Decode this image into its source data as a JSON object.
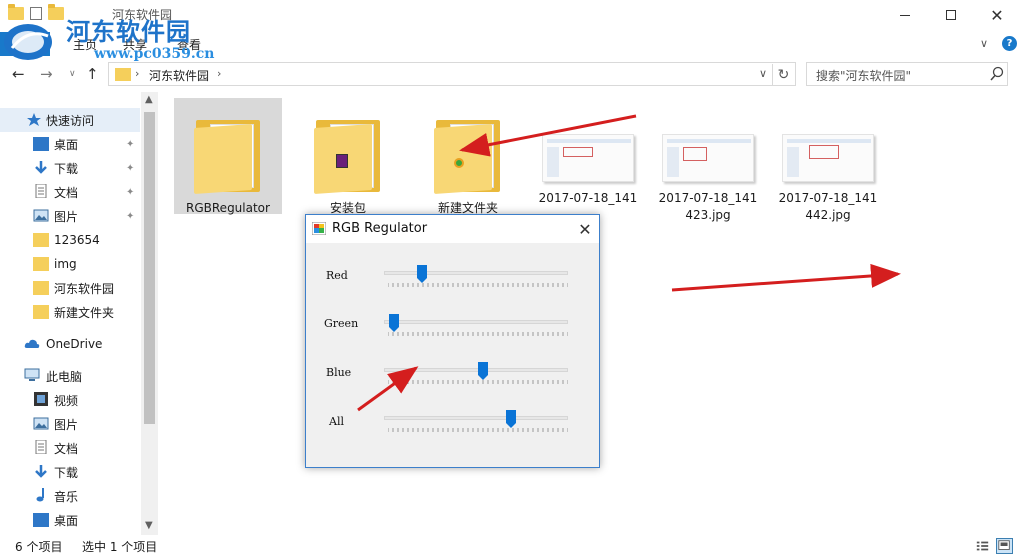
{
  "window": {
    "title": "河东软件园",
    "close_glyph": "✕",
    "help_glyph": "?",
    "ribbon_chevron": "∨"
  },
  "watermark": {
    "title": "河东软件园",
    "url": "www.pc0359.cn"
  },
  "ribbon": {
    "tabs": [
      {
        "label": "文件"
      },
      {
        "label": "主页"
      },
      {
        "label": "共享"
      },
      {
        "label": "查看"
      }
    ]
  },
  "address": {
    "path": "河东软件园",
    "sep": "›",
    "dropdown_glyph": "∨",
    "refresh_glyph": "↻"
  },
  "search": {
    "placeholder": "搜索\"河东软件园\""
  },
  "nav": {
    "back_glyph": "←",
    "forward_glyph": "→",
    "recent_glyph": "∨",
    "up_glyph": "↑"
  },
  "sidebar": {
    "items": [
      {
        "label": "快速访问",
        "icon": "star-icon"
      },
      {
        "label": "桌面",
        "icon": "desktop-icon",
        "pinned": true
      },
      {
        "label": "下载",
        "icon": "download-icon",
        "pinned": true
      },
      {
        "label": "文档",
        "icon": "document-icon",
        "pinned": true
      },
      {
        "label": "图片",
        "icon": "pictures-icon",
        "pinned": true
      },
      {
        "label": "123654",
        "icon": "folder-icon"
      },
      {
        "label": "img",
        "icon": "folder-icon"
      },
      {
        "label": "河东软件园",
        "icon": "folder-icon"
      },
      {
        "label": "新建文件夹",
        "icon": "folder-icon"
      },
      {
        "label": "OneDrive",
        "icon": "cloud-icon"
      },
      {
        "label": "此电脑",
        "icon": "computer-icon"
      },
      {
        "label": "视频",
        "icon": "video-icon"
      },
      {
        "label": "图片",
        "icon": "pictures-icon"
      },
      {
        "label": "文档",
        "icon": "document-icon"
      },
      {
        "label": "下载",
        "icon": "download-icon"
      },
      {
        "label": "音乐",
        "icon": "music-icon"
      },
      {
        "label": "桌面",
        "icon": "desktop-icon"
      }
    ],
    "pin_glyph": "📌"
  },
  "files": [
    {
      "name": "RGBRegulator",
      "type": "folder",
      "selected": true
    },
    {
      "name": "安装包",
      "type": "folder"
    },
    {
      "name": "新建文件夹",
      "type": "folder"
    },
    {
      "name_line1": "2017-07-18_141",
      "name_line2": "",
      "type": "image"
    },
    {
      "name_line1": "2017-07-18_141",
      "name_line2": "423.jpg",
      "type": "image"
    },
    {
      "name_line1": "2017-07-18_141",
      "name_line2": "442.jpg",
      "type": "image"
    }
  ],
  "status": {
    "count": "6 个项目",
    "selected": "选中 1 个项目"
  },
  "dialog": {
    "title": "RGB Regulator",
    "close_glyph": "✕",
    "sliders": [
      {
        "label": "Red",
        "value": 0.19
      },
      {
        "label": "Green",
        "value": 0.03
      },
      {
        "label": "Blue",
        "value": 0.54
      },
      {
        "label": "All",
        "value": 0.7
      }
    ]
  },
  "colors": {
    "accent": "#1979ca",
    "annotation_arrow": "#d41e1e",
    "folder": "#f5cf5b",
    "slider_thumb": "#0a74d6"
  }
}
